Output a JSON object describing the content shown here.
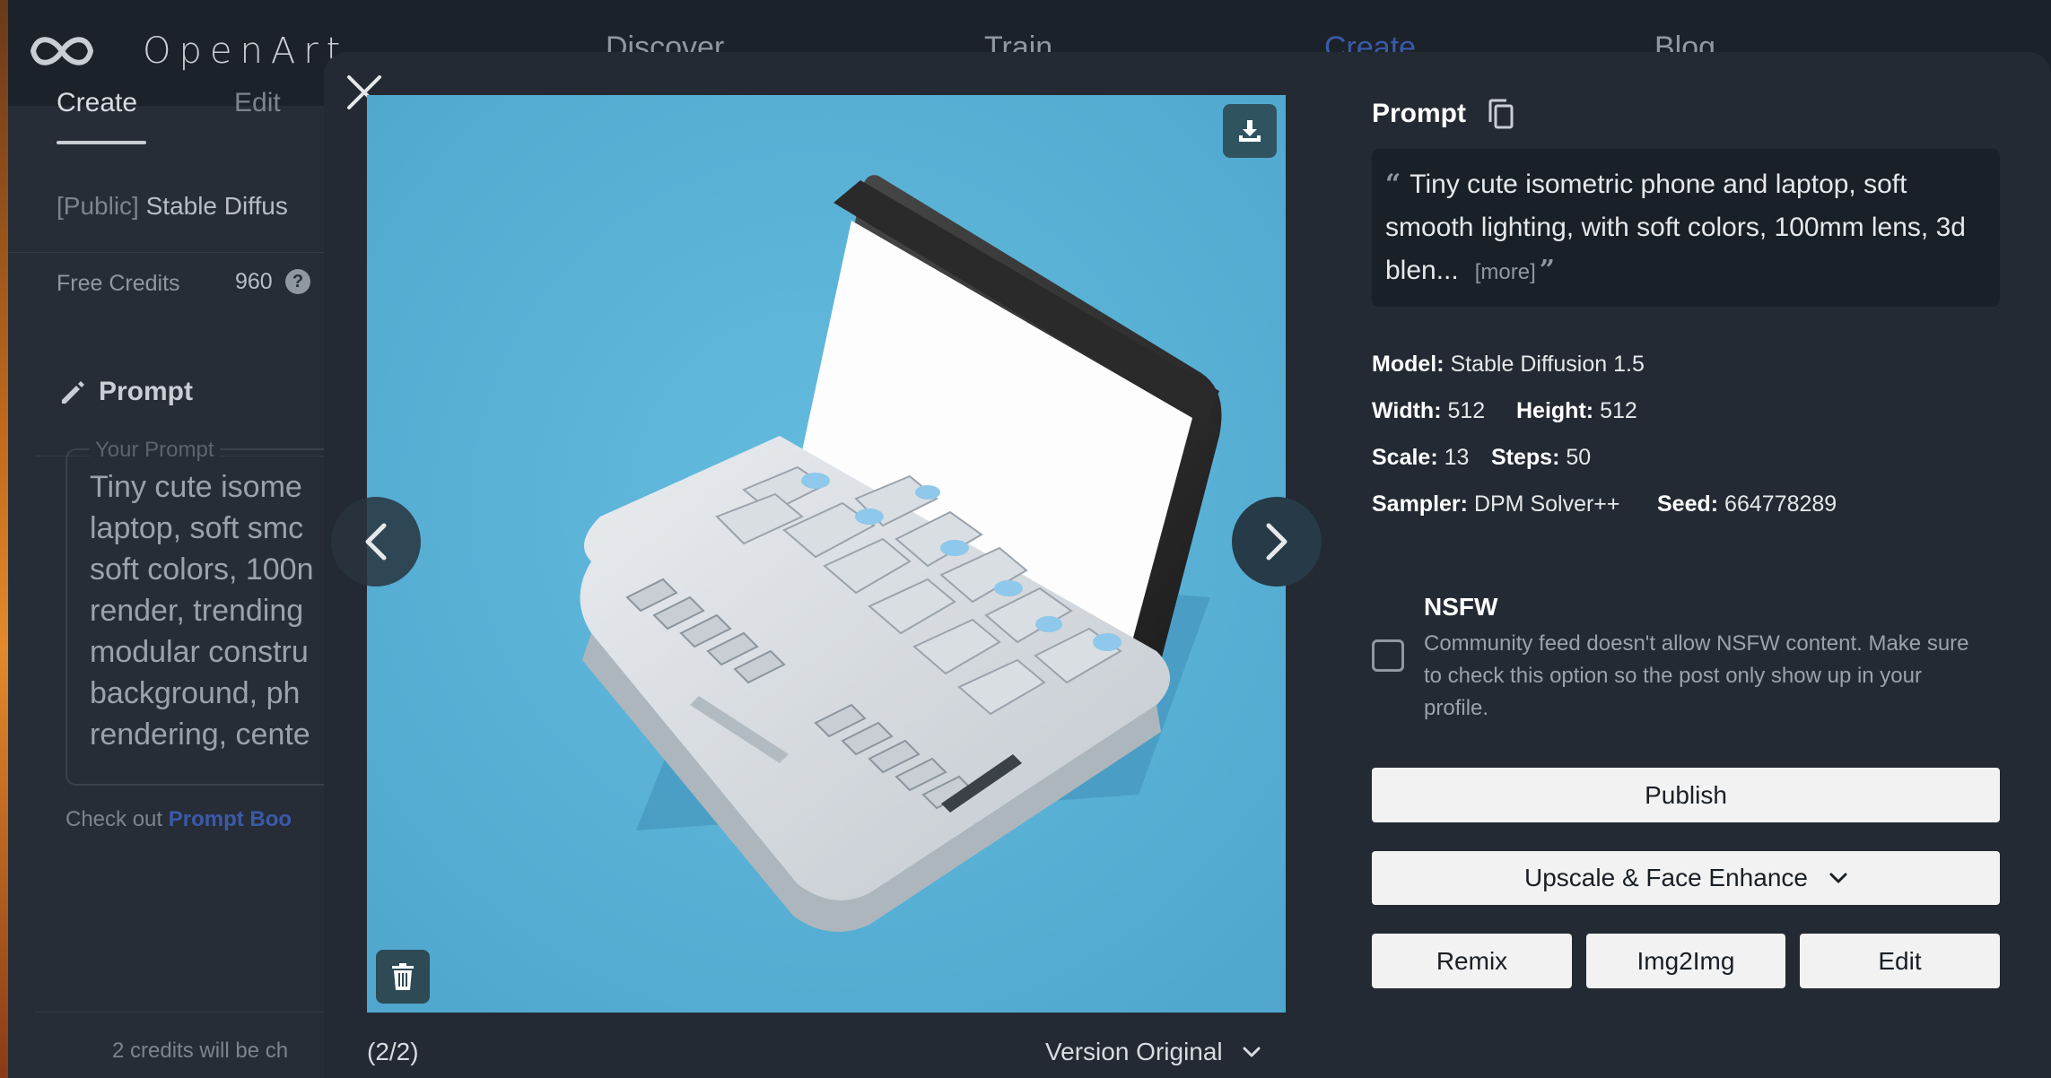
{
  "app": {
    "brand": "OpenArt"
  },
  "nav": {
    "discover": "Discover",
    "train": "Train",
    "create": "Create",
    "blog": "Blog"
  },
  "sidebar": {
    "tab_create": "Create",
    "tab_edit": "Edit",
    "model_prefix": "[Public]",
    "model_name": "Stable Diffus",
    "free_credits_label": "Free Credits",
    "free_credits_value": "960",
    "help_glyph": "?",
    "prompt_heading": "Prompt",
    "prompt_legend": "Your Prompt",
    "prompt_lines": [
      "Tiny cute isome",
      "laptop, soft smc",
      "soft colors, 100n",
      "render, trending",
      "modular constru",
      "background, ph",
      "rendering, cente"
    ],
    "check_out_text": "Check out",
    "check_out_link": "Prompt Boo",
    "cost_text": "2 credits will be ch"
  },
  "viewer": {
    "counter": "(2/2)",
    "version_label": "Version Original"
  },
  "details": {
    "prompt_heading": "Prompt",
    "prompt_text": "Tiny cute isometric phone and laptop, soft smooth lighting, with soft colors, 100mm lens, 3d blen...",
    "more_label": "[more]",
    "model_label": "Model:",
    "model_value": "Stable Diffusion 1.5",
    "width_label": "Width:",
    "width_value": "512",
    "height_label": "Height:",
    "height_value": "512",
    "scale_label": "Scale:",
    "scale_value": "13",
    "steps_label": "Steps:",
    "steps_value": "50",
    "sampler_label": "Sampler:",
    "sampler_value": "DPM Solver++",
    "seed_label": "Seed:",
    "seed_value": "664778289"
  },
  "nsfw": {
    "title": "NSFW",
    "description": "Community feed doesn't allow NSFW content. Make sure to check this option so the post only show up in your profile.",
    "checked": false
  },
  "actions": {
    "publish": "Publish",
    "upscale": "Upscale & Face Enhance",
    "remix": "Remix",
    "img2img": "Img2Img",
    "edit": "Edit"
  },
  "colors": {
    "accent": "#3b5aa8",
    "image_bg": "#5bb3d6",
    "button_bg": "#f2f2f2"
  }
}
